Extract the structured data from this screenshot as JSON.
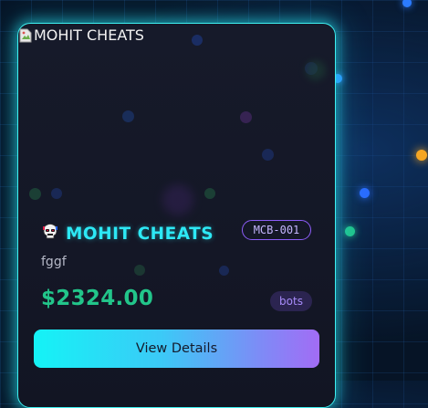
{
  "product_card": {
    "image_alt": "MOHIT CHEATS",
    "brand_name": "MOHIT CHEATS",
    "brand_icon": "skull-robot-icon",
    "code": "MCB-001",
    "description": "fggf",
    "price": "$2324.00",
    "tag": "bots",
    "button_label": "View Details"
  },
  "colors": {
    "card_border": "#3ef0f0",
    "brand_text": "#2de8f5",
    "price_text": "#22c58a",
    "badge_border": "#8b5cf6",
    "button_gradient_start": "#14f3f6",
    "button_gradient_end": "#a26cf5"
  }
}
